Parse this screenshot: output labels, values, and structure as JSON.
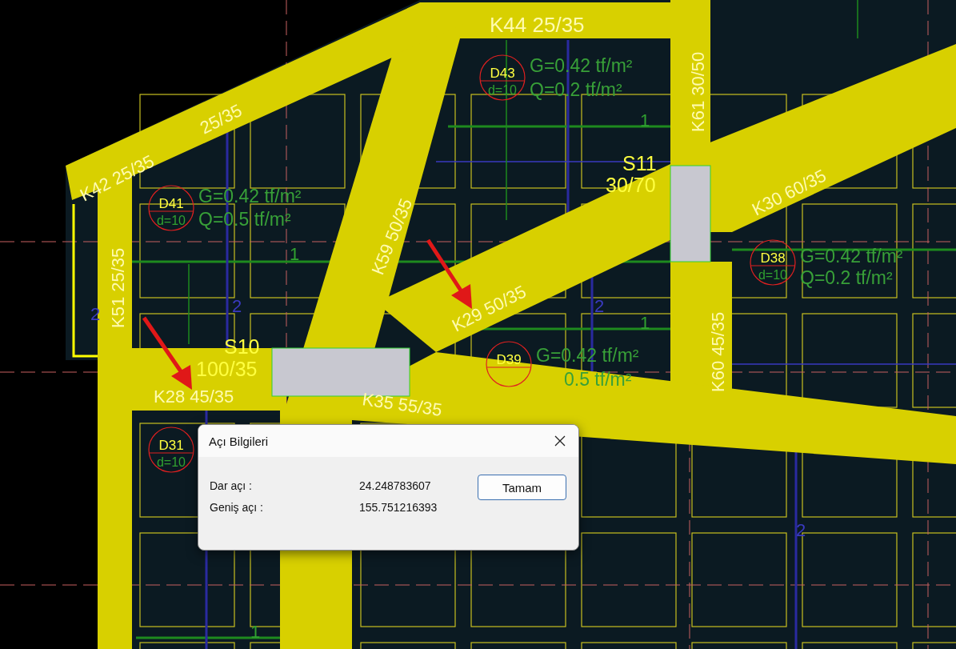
{
  "canvas": {
    "beam_labels": [
      "K44 25/35",
      "K42 25/35",
      "25/35",
      "K51 25/35",
      "K59 50/35",
      "K61 30/50",
      "K30 60/35",
      "K29 50/35",
      "K28 45/35",
      "K35 55/35",
      "K60 45/35"
    ],
    "columns": [
      {
        "name": "S10",
        "size": "100/35"
      },
      {
        "name": "S11",
        "size": "30/70"
      }
    ],
    "slabs": [
      {
        "name": "D41",
        "thickness": "d=10",
        "loads": [
          "G=0.42 tf/m²",
          "Q=0.5 tf/m²"
        ]
      },
      {
        "name": "D43",
        "thickness": "d=10",
        "loads": [
          "G=0.42 tf/m²",
          "Q=0.2 tf/m²"
        ]
      },
      {
        "name": "D38",
        "thickness": "d=10",
        "loads": [
          "G=0.42 tf/m²",
          "Q=0.2 tf/m²"
        ]
      },
      {
        "name": "D39",
        "loads": [
          "G=0.42 tf/m²",
          "0.5 tf/m²"
        ]
      },
      {
        "name": "D31",
        "thickness": "d=10"
      }
    ],
    "span_marks": [
      "1",
      "1",
      "1",
      "1",
      "2",
      "2",
      "2",
      "2"
    ]
  },
  "dialog": {
    "title": "Açı Bilgileri",
    "rows": [
      {
        "label": "Dar açı :",
        "value": "24.248783607"
      },
      {
        "label": "Geniş açı :",
        "value": "155.751216393"
      }
    ],
    "button": "Tamam"
  }
}
